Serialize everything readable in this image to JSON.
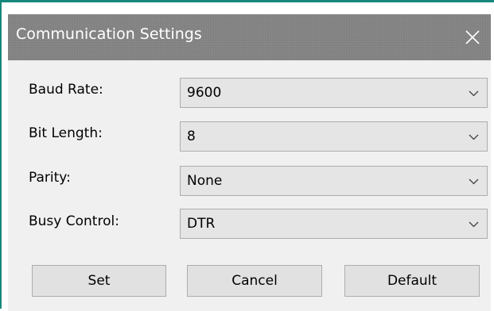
{
  "window": {
    "title": "Communication Settings",
    "close_glyph": "close-icon"
  },
  "fields": [
    {
      "label": "Baud Rate:",
      "value": "9600"
    },
    {
      "label": "Bit Length:",
      "value": "8"
    },
    {
      "label": "Parity:",
      "value": "None"
    },
    {
      "label": "Busy Control:",
      "value": "DTR"
    }
  ],
  "buttons": {
    "set": "Set",
    "cancel": "Cancel",
    "default": "Default"
  },
  "colors": {
    "titlebar": "#7f7f7f",
    "dialog_bg": "#f0f0f0",
    "accent_border": "#16877b"
  }
}
